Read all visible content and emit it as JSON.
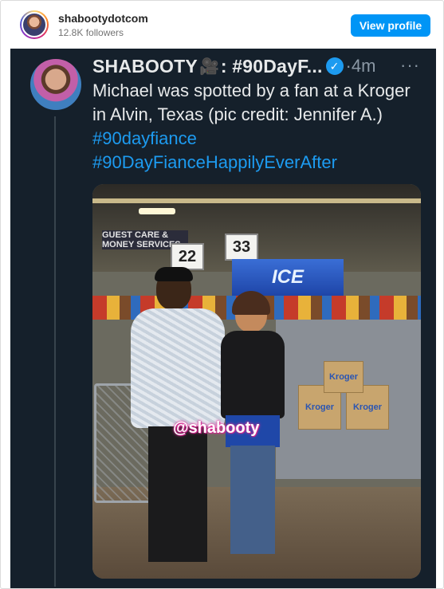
{
  "header": {
    "username": "shabootydotcom",
    "followers": "12.8K followers",
    "view_profile_label": "View profile"
  },
  "tweet": {
    "display_name": "SHABOOTY",
    "name_suffix": ": #90DayF...",
    "camera_glyph": "🎥",
    "separator": "·",
    "time": "4m",
    "more": "···",
    "body_text": "Michael was spotted by a fan at a Kroger in Alvin, Texas (pic credit: Jennifer A.)",
    "hashtag1": "#90dayfiance",
    "hashtag2": "#90DayFianceHappilyEverAfter"
  },
  "photo": {
    "watermark": "@shabooty",
    "wall_sign": "GUEST CARE & MONEY SERVICES",
    "lane_a": "22",
    "lane_b": "33",
    "ice_sign": "ICE",
    "bag_label": "Kroger"
  },
  "colors": {
    "brand_button": "#0095f6",
    "tweet_bg": "#15202b",
    "hashtag": "#1d9bf0"
  }
}
